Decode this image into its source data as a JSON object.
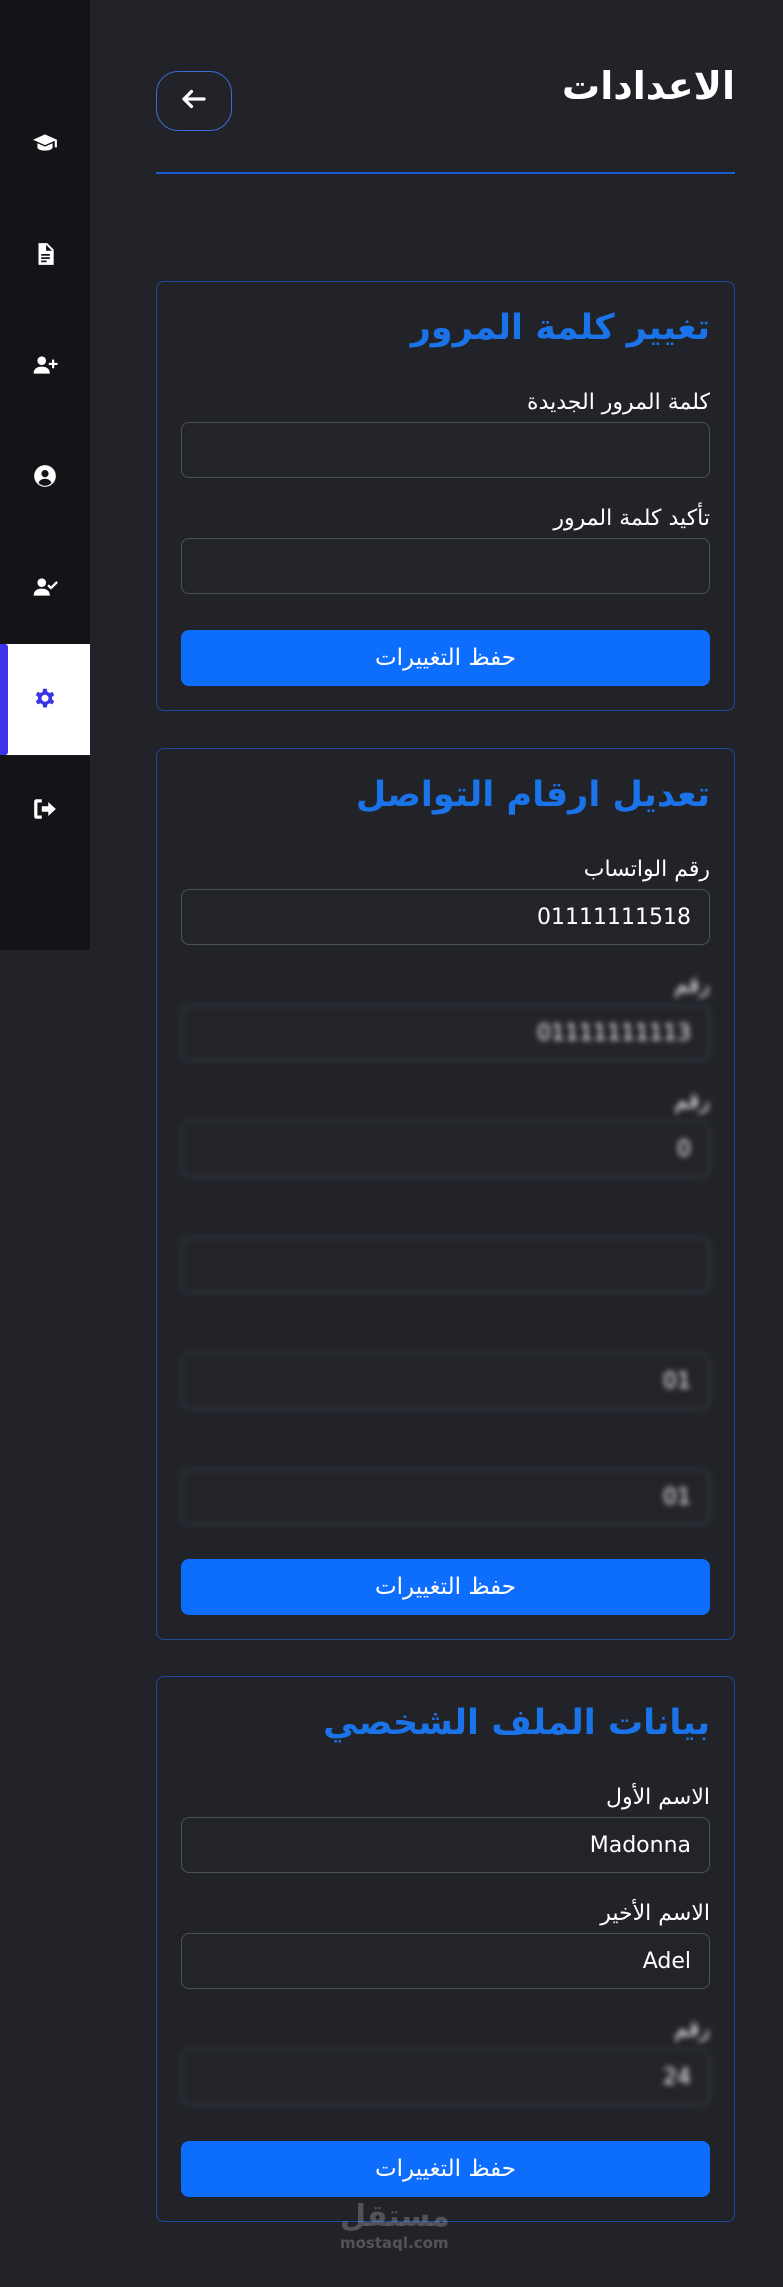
{
  "page": {
    "title": "الاعدادات"
  },
  "sidebar": {
    "items": [
      {
        "icon": "graduation-cap-icon",
        "active": false
      },
      {
        "icon": "document-icon",
        "active": false
      },
      {
        "icon": "user-plus-icon",
        "active": false
      },
      {
        "icon": "user-circle-icon",
        "active": false
      },
      {
        "icon": "user-check-icon",
        "active": false
      },
      {
        "icon": "gear-icon",
        "active": true
      },
      {
        "icon": "sign-out-icon",
        "active": false
      }
    ]
  },
  "password_card": {
    "title": "تغيير كلمة المرور",
    "new_password_label": "كلمة المرور الجديدة",
    "new_password_value": "",
    "confirm_password_label": "تأكيد كلمة المرور",
    "confirm_password_value": "",
    "save_label": "حفظ التغييرات"
  },
  "contact_card": {
    "title": "تعديل ارقام التواصل",
    "fields": [
      {
        "label": "رقم الواتساب",
        "value": "01111111518"
      },
      {
        "label": "رقم",
        "value": "01111111113"
      },
      {
        "label": "رقم",
        "value": "0"
      },
      {
        "label": "",
        "value": ""
      },
      {
        "label": "",
        "value": "01"
      },
      {
        "label": "",
        "value": "01"
      }
    ],
    "save_label": "حفظ التغييرات"
  },
  "profile_card": {
    "title": "بيانات الملف الشخصي",
    "first_name_label": "الاسم الأول",
    "first_name_value": "Madonna",
    "last_name_label": "الاسم الأخير",
    "last_name_value": "Adel",
    "phone_label": "رقم",
    "phone_value": "24",
    "save_label": "حفظ التغييرات"
  },
  "watermark": {
    "arabic": "مستقل",
    "latin": "mostaql.com"
  },
  "colors": {
    "background": "#212329",
    "sidebar": "#141418",
    "accent": "#0d6efd",
    "title_blue": "#1a73e8",
    "active_indicator": "#3b34e6"
  }
}
